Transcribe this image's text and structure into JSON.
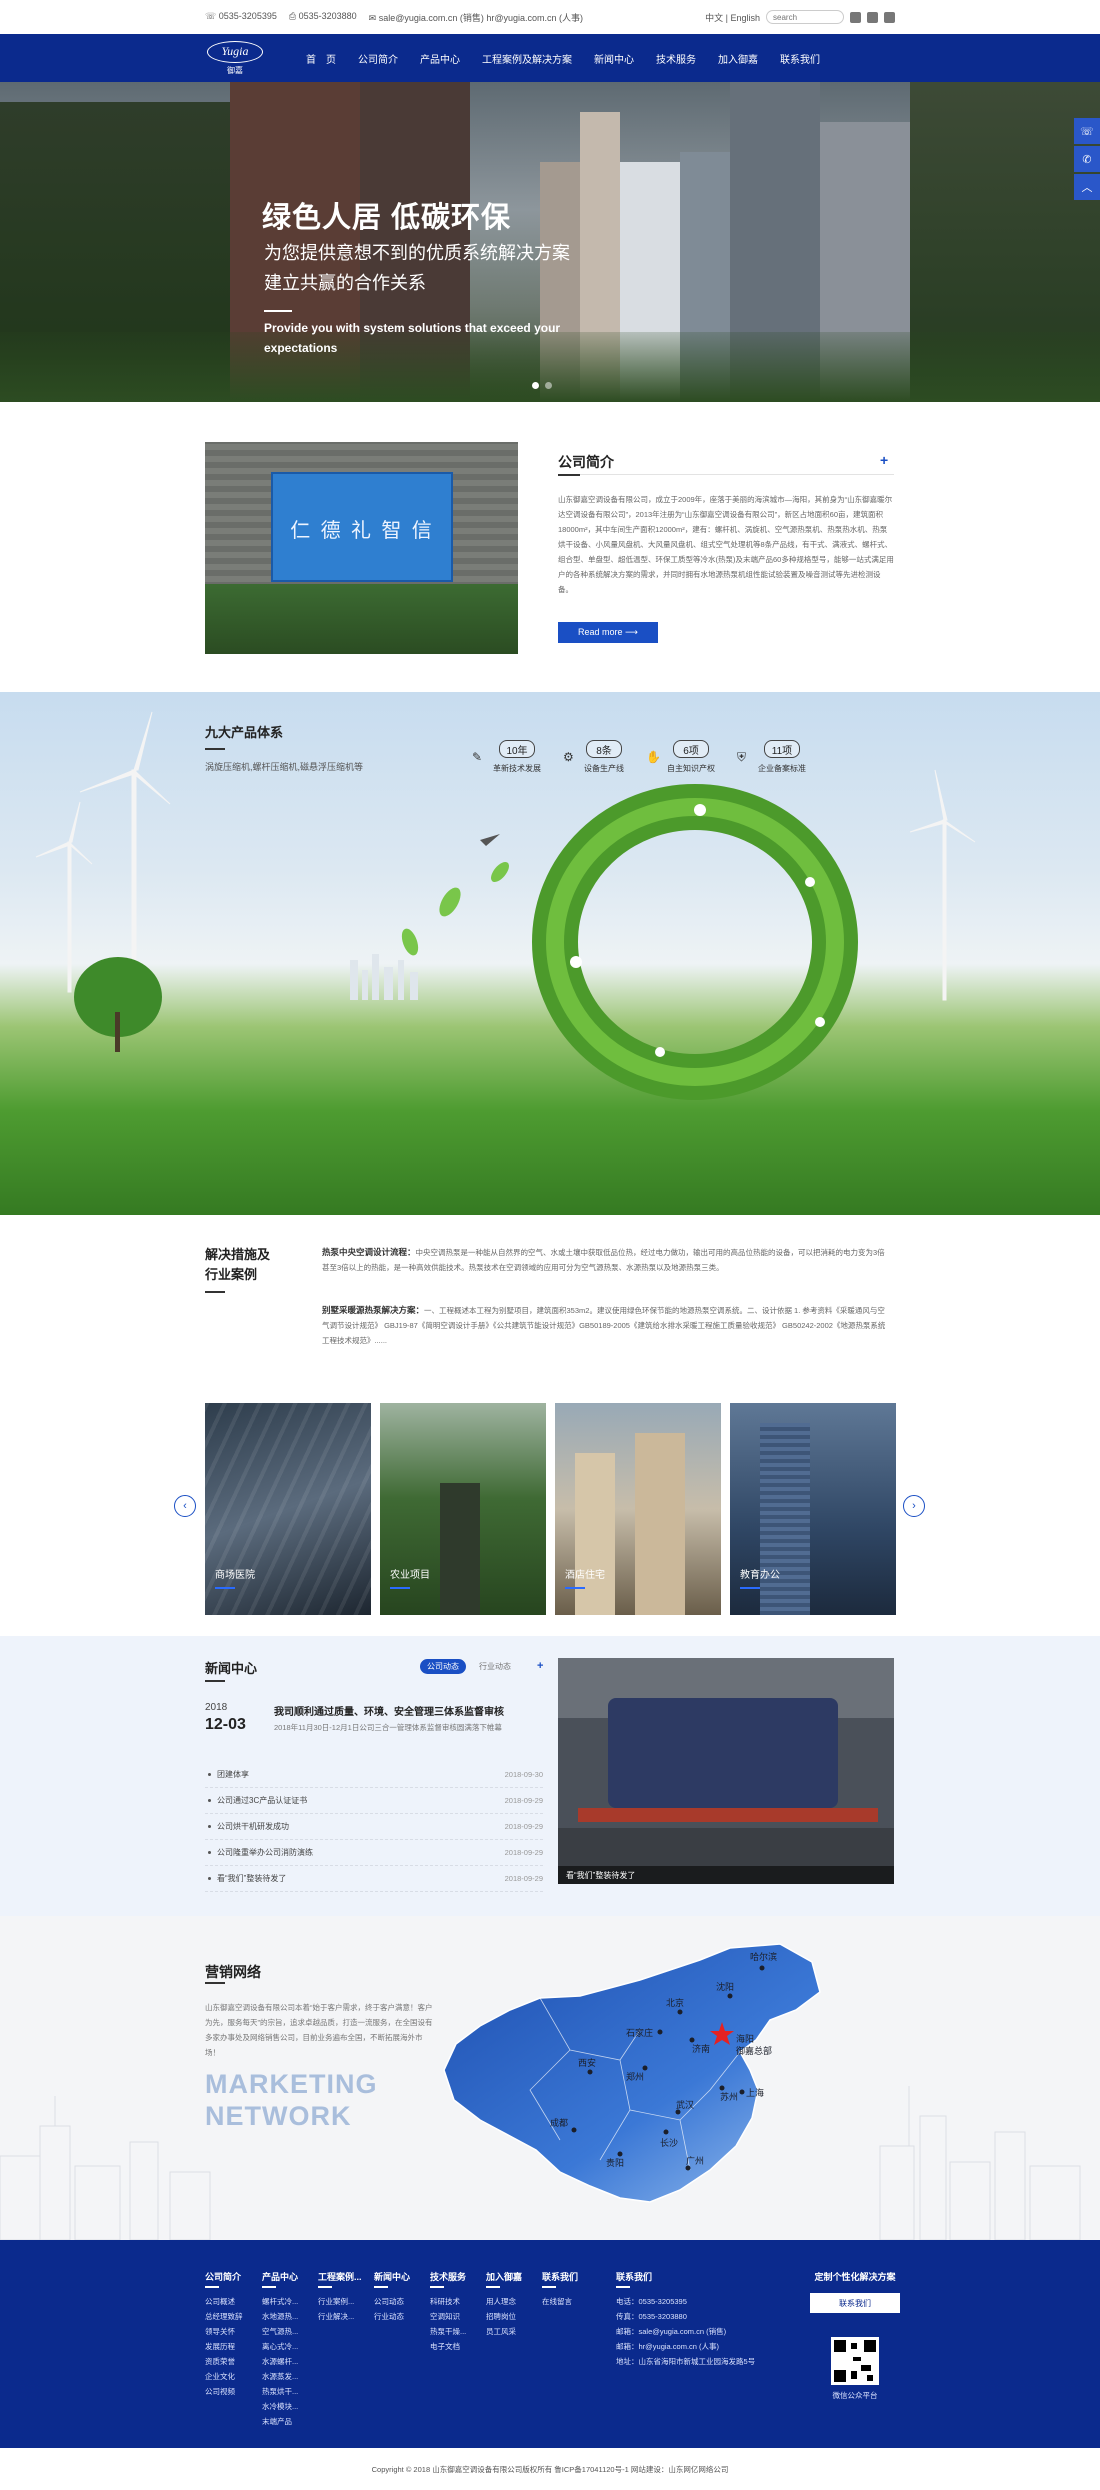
{
  "topbar": {
    "phone": "0535-3205395",
    "fax": "0535-3203880",
    "email": "sale@yugia.com.cn (销售) hr@yugia.com.cn (人事)",
    "lang": "中文 | English",
    "search_placeholder": "search"
  },
  "logo": {
    "text": "Yugia",
    "cn": "御嘉"
  },
  "nav": [
    "首　页",
    "公司简介",
    "产品中心",
    "工程案例及解决方案",
    "新闻中心",
    "技术服务",
    "加入御嘉",
    "联系我们"
  ],
  "hero": {
    "title": "绿色人居 低碳环保",
    "line1": "为您提供意想不到的优质系统解决方案",
    "line2": "建立共赢的合作关系",
    "en": "Provide you with system solutions that exceed your expectations"
  },
  "about": {
    "title": "公司简介",
    "sign": "仁 德 礼 智 信",
    "body": "山东御嘉空调设备有限公司，成立于2009年，座落于美丽的海滨城市—海阳，其前身为“山东御嘉暖尔达空调设备有限公司”，2013年注册为“山东御嘉空调设备有限公司”，新区占地面积60亩，建筑面积18000m²，其中车间生产面积12000m²，建有：螺杆机、涡旋机、空气源热泵机、热泵热水机、热泵烘干设备、小风量风盘机、大风量风盘机、组式空气处理机等8条产品线，有干式、满液式、螺杆式、组合型、单盘型、超低温型、环保工质型等冷水(热泵)及末端产品60多种规格型号，能够一站式满足用户的各种系统解决方案的需求，并同时拥有水地源热泵机组性能试验装置及噪音测试等先进检测设备。",
    "more": "Read more ⟶"
  },
  "products": {
    "title": "九大产品体系",
    "subtitle": "涡旋压缩机,螺杆压缩机,磁悬浮压缩机等",
    "stats": [
      {
        "num": "10年",
        "label": "革新技术发展",
        "icon": "wrench-icon"
      },
      {
        "num": "8条",
        "label": "设备生产线",
        "icon": "gear-icon"
      },
      {
        "num": "6项",
        "label": "自主知识产权",
        "icon": "hand-icon"
      },
      {
        "num": "11项",
        "label": "企业备案标准",
        "icon": "shield-icon"
      }
    ]
  },
  "solutions": {
    "title1": "解决措施及",
    "title2": "行业案例",
    "items": [
      {
        "head": "热泵中央空调设计流程：",
        "text": "中央空调热泵是一种能从自然界的空气、水或土壤中获取低品位热，经过电力做功，输出可用的高品位热能的设备，可以把消耗的电力变为3倍甚至3倍以上的热能，是一种高效供能技术。热泵技术在空调领域的应用可分为空气源热泵、水源热泵以及地源热泵三类。"
      },
      {
        "head": "别墅采暖源热泵解决方案：",
        "text": "一、工程概述本工程为别墅项目，建筑面积353m2。建议使用绿色环保节能的地源热泵空调系统。二、设计依据 1. 参考资料《采暖通风与空气调节设计规范》 GBJ19-87《简明空调设计手册》《公共建筑节能设计规范》GB50189-2005《建筑给水排水采暖工程施工质量验收规范》 GB50242-2002《地源热泵系统工程技术规范》......"
      }
    ]
  },
  "cases": [
    "商场医院",
    "农业项目",
    "酒店住宅",
    "教育办公"
  ],
  "news": {
    "title": "新闻中心",
    "tabs": [
      "公司动态",
      "行业动态"
    ],
    "year": "2018",
    "day": "12-03",
    "feature_title": "我司顺利通过质量、环境、安全管理三体系监督审核",
    "feature_desc": "2018年11月30日-12月1日公司三合一管理体系监督审核圆满落下帷幕",
    "list": [
      {
        "t": "团建体享",
        "d": "2018-09-30"
      },
      {
        "t": "公司通过3C产品认证证书",
        "d": "2018-09-29"
      },
      {
        "t": "公司烘干机研发成功",
        "d": "2018-09-29"
      },
      {
        "t": "公司隆重举办公司消防演练",
        "d": "2018-09-29"
      },
      {
        "t": "看“我们”整装待发了",
        "d": "2018-09-29"
      }
    ],
    "pic_caption": "看“我们”整装待发了"
  },
  "network": {
    "title": "营销网络",
    "desc": "山东御嘉空调设备有限公司本着“始于客户需求，终于客户满意！客户为先，服务每天”的宗旨，追求卓越品质，打造一流服务，在全国设有多家办事处及网络销售公司，目前业务遍布全国，不断拓展海外市场！",
    "big1": "MARKETING",
    "big2": "NETWORK",
    "cities": [
      "哈尔滨",
      "北京",
      "沈阳",
      "石家庄",
      "济南",
      "西安",
      "海阳",
      "郑州",
      "苏州",
      "上海",
      "武汉",
      "成都",
      "长沙",
      "贵阳",
      "广州"
    ],
    "hq": "御嘉总部"
  },
  "footer": {
    "cols": [
      {
        "h": "公司简介",
        "items": [
          "公司概述",
          "总经理致辞",
          "领导关怀",
          "发展历程",
          "资质荣誉",
          "企业文化",
          "公司视频"
        ]
      },
      {
        "h": "产品中心",
        "items": [
          "螺杆式冷...",
          "水地源热...",
          "空气源热...",
          "离心式冷...",
          "水源螺杆...",
          "水源蒸发...",
          "热泵烘干...",
          "水冷模块...",
          "末端产品"
        ]
      },
      {
        "h": "工程案例...",
        "items": [
          "行业案例...",
          "行业解决..."
        ]
      },
      {
        "h": "新闻中心",
        "items": [
          "公司动态",
          "行业动态"
        ]
      },
      {
        "h": "技术服务",
        "items": [
          "科研技术",
          "空调知识",
          "热泵干燥...",
          "电子文档"
        ]
      },
      {
        "h": "加入御嘉",
        "items": [
          "用人理念",
          "招聘岗位",
          "员工风采"
        ]
      },
      {
        "h": "联系我们",
        "items": [
          "在线留言"
        ]
      }
    ],
    "contact_h": "联系我们",
    "contact": [
      "电话：0535-3205395",
      "传真：0535-3203880",
      "邮箱：sale@yugia.com.cn (销售)",
      "邮箱：hr@yugia.com.cn (人事)",
      "地址：山东省海阳市新城工业园海发路5号"
    ],
    "custom_h": "定制个性化解决方案",
    "contact_btn": "联系我们",
    "qr_caption": "微信公众平台"
  },
  "copyright": "Copyright © 2018 山东御嘉空调设备有限公司版权所有  鲁ICP备17041120号-1  网站建设：山东网亿网络公司"
}
